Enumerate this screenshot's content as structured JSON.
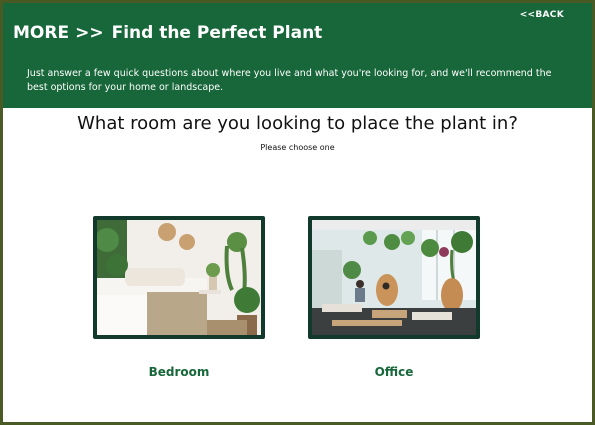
{
  "header": {
    "back_label": "<<BACK",
    "more_label": "MORE",
    "arrows": ">>",
    "title": "Find the Perfect Plant",
    "intro": "Just answer a few quick questions about where you live and what you're looking for, and we'll recommend the best options for your home or landscape."
  },
  "question": {
    "text": "What room are you looking to place the plant in?",
    "instruction": "Please choose one"
  },
  "options": [
    {
      "label": "Bedroom"
    },
    {
      "label": "Office"
    }
  ],
  "colors": {
    "header_green": "#17673a",
    "card_border": "#123a2c",
    "label_green": "#17673a"
  }
}
